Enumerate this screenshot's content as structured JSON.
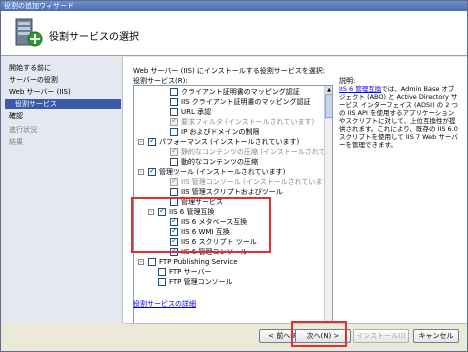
{
  "window": {
    "title": "役割の追加ウィザード"
  },
  "header": {
    "title": "役割サービスの選択"
  },
  "nav": {
    "items": [
      {
        "label": "開始する前に",
        "selected": false,
        "disabled": false
      },
      {
        "label": "サーバーの役割",
        "selected": false,
        "disabled": false
      },
      {
        "label": "Web サーバー (IIS)",
        "selected": false,
        "disabled": false
      },
      {
        "label": "役割サービス",
        "selected": true,
        "disabled": false
      },
      {
        "label": "確認",
        "selected": false,
        "disabled": false
      },
      {
        "label": "進行状況",
        "selected": false,
        "disabled": true
      },
      {
        "label": "結果",
        "selected": false,
        "disabled": true
      }
    ]
  },
  "main": {
    "description": "Web サーバー (IIS) にインストールする役割サービスを選択:",
    "roles_label": "役割サービス(R):",
    "explain_label": "説明:",
    "explain_link": "IIS 6 管理互換",
    "explain_text": "では、Admin Base オブジェクト (ABO) と Active Directory サービス インターフェイス (ADSI) の 2 つの IIS API を使用するアプリケーションやスクリプトに対して、上位互換性が提供されます。これにより、既存の IIS 6.0 スクリプトを使用して IIS 7 Web サーバーを管理できます。",
    "details_link": "役割サービスの詳細"
  },
  "tree": {
    "items": [
      {
        "label": "クライアント証明書のマッピング認証",
        "checked": false,
        "gray": false,
        "expander": ""
      },
      {
        "label": "IIS クライアント証明書のマッピング認証",
        "checked": false,
        "gray": false,
        "expander": ""
      },
      {
        "label": "URL 承認",
        "checked": false,
        "gray": false,
        "expander": ""
      },
      {
        "label": "要求フィルタ (インストールされています)",
        "checked": true,
        "gray": true,
        "expander": ""
      },
      {
        "label": "IP およびドメインの制限",
        "checked": false,
        "gray": false,
        "expander": ""
      },
      {
        "label": "パフォーマンス (インストールされています)",
        "checked": true,
        "gray": false,
        "expander": "-"
      },
      {
        "label": "静的なコンテンツの圧縮 (インストールされています)",
        "checked": true,
        "gray": true,
        "expander": ""
      },
      {
        "label": "動的なコンテンツの圧縮",
        "checked": false,
        "gray": false,
        "expander": ""
      },
      {
        "label": "管理ツール (インストールされています)",
        "checked": true,
        "gray": false,
        "expander": "-"
      },
      {
        "label": "IIS 管理コンソール (インストールされています)",
        "checked": true,
        "gray": true,
        "expander": ""
      },
      {
        "label": "IIS 管理スクリプトおよびツール",
        "checked": false,
        "gray": false,
        "expander": ""
      },
      {
        "label": "管理サービス",
        "checked": false,
        "gray": false,
        "expander": ""
      },
      {
        "label": "IIS 6 管理互換",
        "checked": true,
        "gray": false,
        "expander": "-"
      },
      {
        "label": "IIS 6 メタベース互換",
        "checked": true,
        "gray": false,
        "expander": ""
      },
      {
        "label": "IIS 6 WMI 互換",
        "checked": true,
        "gray": false,
        "expander": ""
      },
      {
        "label": "IIS 6 スクリプト ツール",
        "checked": true,
        "gray": false,
        "expander": ""
      },
      {
        "label": "IIS 6 管理コンソール",
        "checked": true,
        "gray": false,
        "expander": ""
      },
      {
        "label": "FTP Publishing Service",
        "checked": false,
        "gray": false,
        "expander": "-"
      },
      {
        "label": "FTP サーバー",
        "checked": false,
        "gray": false,
        "expander": ""
      },
      {
        "label": "FTP 管理コンソール",
        "checked": false,
        "gray": false,
        "expander": ""
      }
    ]
  },
  "footer": {
    "back": "< 前へ(P)",
    "next": "次へ(N) >",
    "install": "インストール(I)",
    "cancel": "キャンセル"
  }
}
